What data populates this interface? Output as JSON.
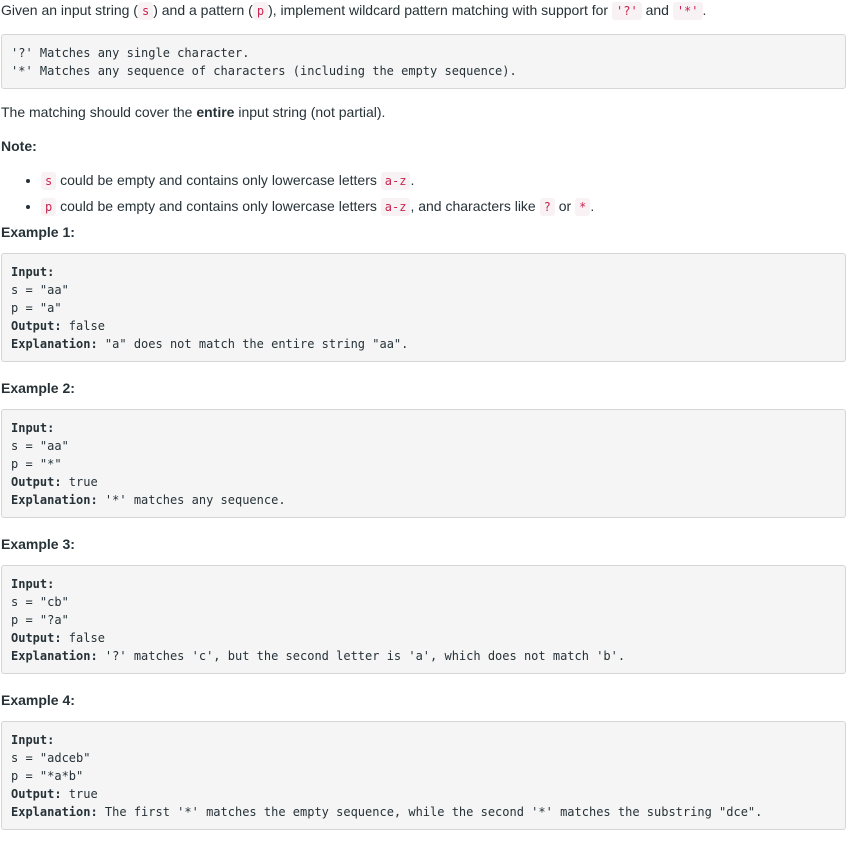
{
  "intro": {
    "t1": "Given an input string (",
    "s": "s",
    "t2": ") and a pattern (",
    "p": "p",
    "t3": "), implement wildcard pattern matching with support for ",
    "q": "'?'",
    "t4": " and ",
    "star": "'*'",
    "t5": "."
  },
  "definitions": {
    "line1": "'?' Matches any single character.",
    "line2": "'*' Matches any sequence of characters (including the empty sequence)."
  },
  "coverage": {
    "t1": "The matching should cover the ",
    "bold": "entire",
    "t2": " input string (not partial)."
  },
  "note": {
    "label": "Note:",
    "bullets": [
      {
        "code": "s",
        "t1": " could be empty and contains only lowercase letters ",
        "code2": "a-z",
        "t2": "."
      },
      {
        "code": "p",
        "t1": " could be empty and contains only lowercase letters ",
        "code2": "a-z",
        "t2": ", and characters like ",
        "code3": "?",
        "t3": " or ",
        "code4": "*",
        "t4": "."
      }
    ]
  },
  "labels": {
    "input": "Input:",
    "output": "Output:",
    "explanation": "Explanation:"
  },
  "examples": [
    {
      "title": "Example 1:",
      "s": "s = \"aa\"",
      "p": "p = \"a\"",
      "output": " false",
      "explanation": " \"a\" does not match the entire string \"aa\"."
    },
    {
      "title": "Example 2:",
      "s": "s = \"aa\"",
      "p": "p = \"*\"",
      "output": " true",
      "explanation": " '*' matches any sequence."
    },
    {
      "title": "Example 3:",
      "s": "s = \"cb\"",
      "p": "p = \"?a\"",
      "output": " false",
      "explanation": " '?' matches 'c', but the second letter is 'a', which does not match 'b'."
    },
    {
      "title": "Example 4:",
      "s": "s = \"adceb\"",
      "p": "p = \"*a*b\"",
      "output": " true",
      "explanation": " The first '*' matches the empty sequence, while the second '*' matches the substring \"dce\"."
    }
  ]
}
